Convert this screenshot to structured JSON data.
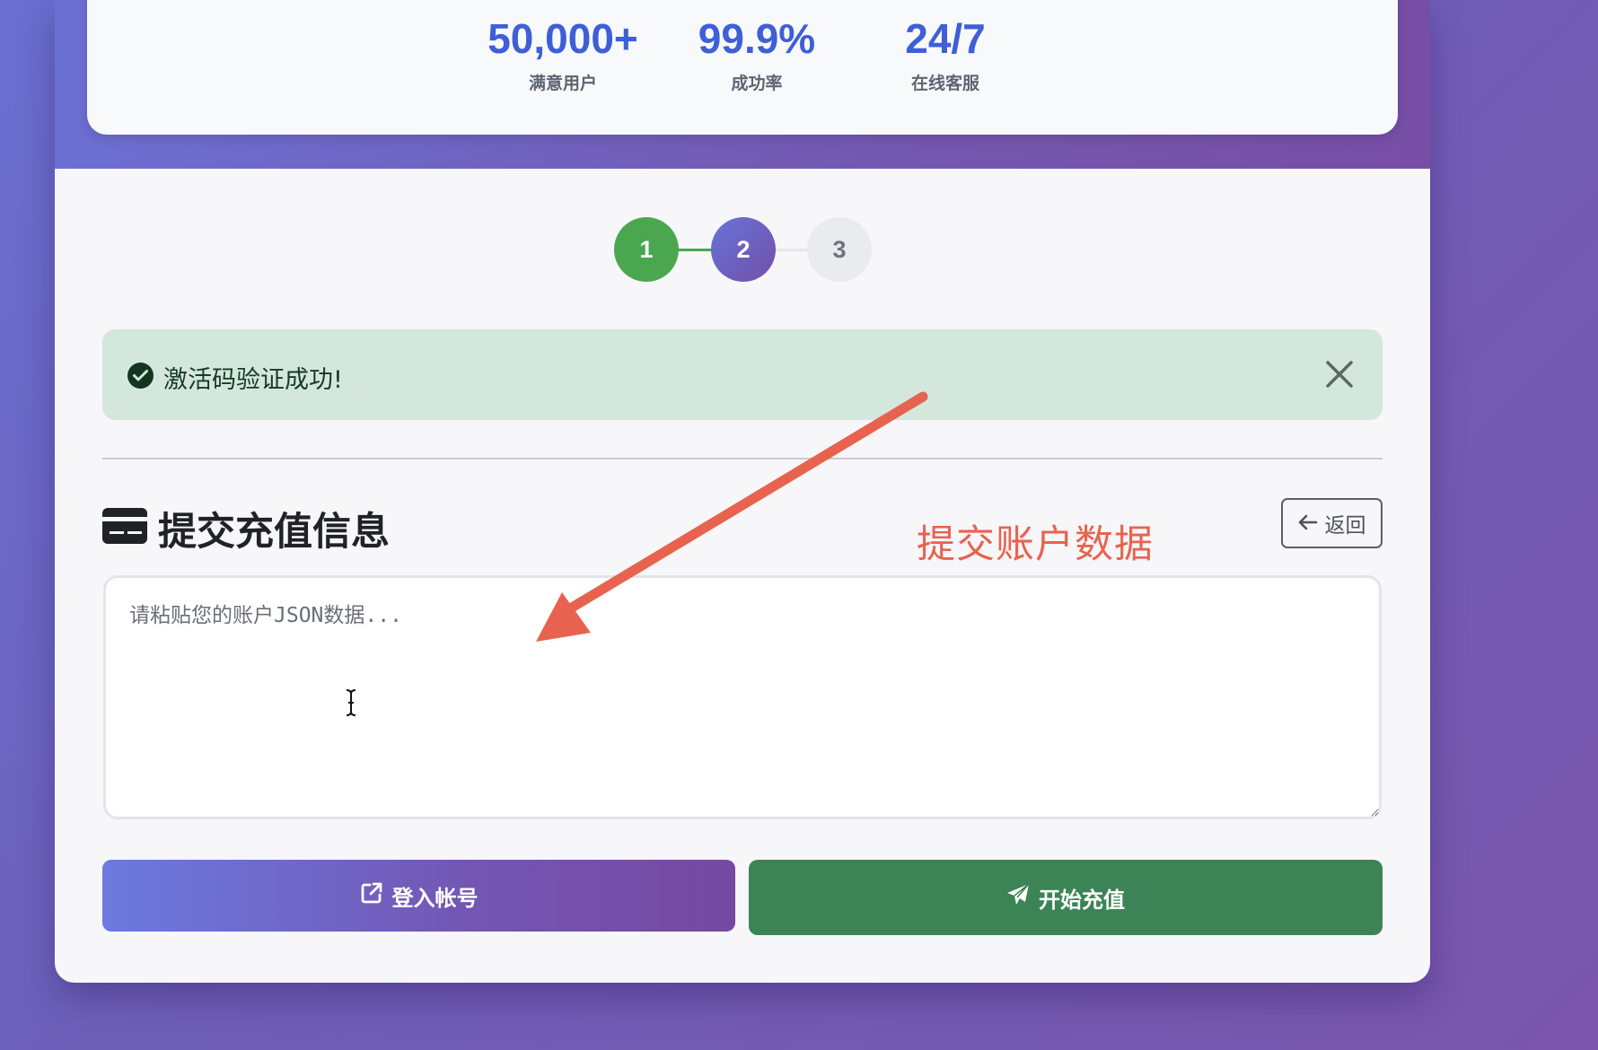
{
  "stats": [
    {
      "value": "50,000+",
      "label": "满意用户"
    },
    {
      "value": "99.9%",
      "label": "成功率"
    },
    {
      "value": "24/7",
      "label": "在线客服"
    }
  ],
  "steps": {
    "current": 2,
    "items": [
      {
        "number": "1",
        "state": "complete"
      },
      {
        "number": "2",
        "state": "active"
      },
      {
        "number": "3",
        "state": "pending"
      }
    ]
  },
  "alert": {
    "message": "激活码验证成功!"
  },
  "section": {
    "title": "提交充值信息",
    "back_label": "返回"
  },
  "json_input": {
    "placeholder": "请粘贴您的账户JSON数据...",
    "value": ""
  },
  "actions": {
    "login_label": "登入帐号",
    "start_label": "开始充值"
  },
  "annotation": {
    "text": "提交账户数据"
  },
  "colors": {
    "accent": "#3e5fd6",
    "success": "#4aa750",
    "success_button": "#3c8455",
    "annotation": "#e8634f"
  }
}
